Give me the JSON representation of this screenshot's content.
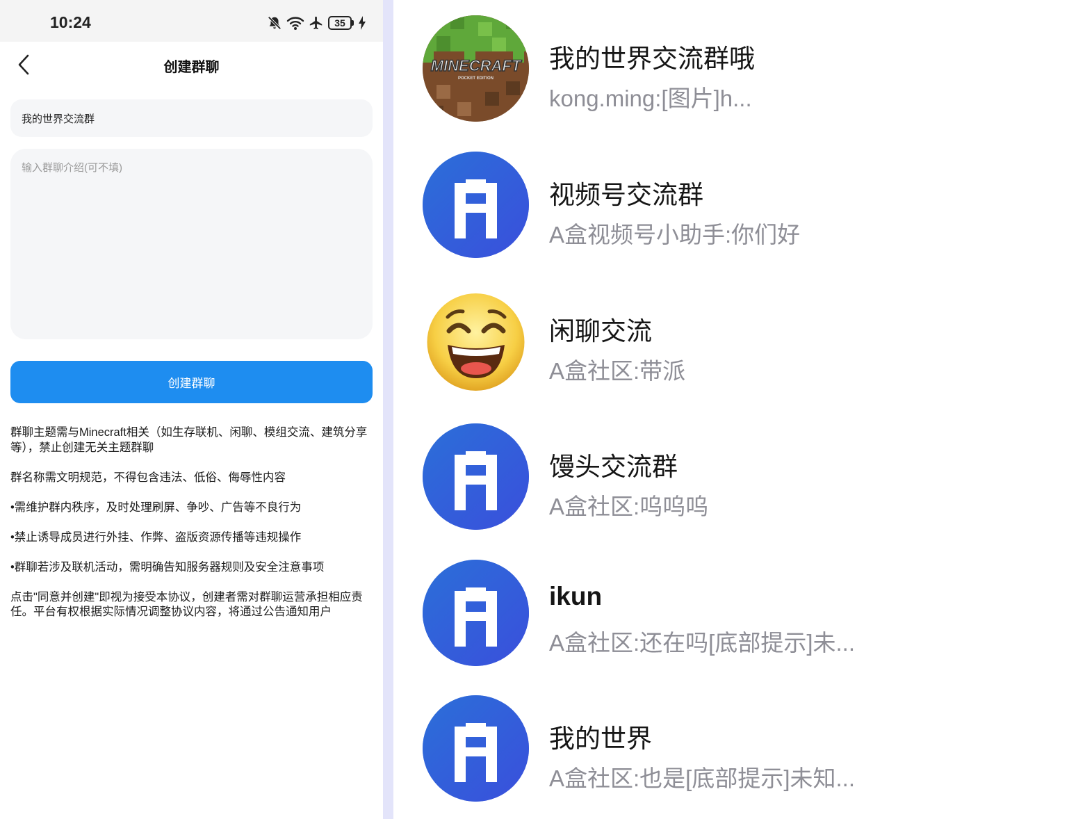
{
  "status_bar": {
    "time": "10:24",
    "battery": "35",
    "icons": [
      "bell-off-icon",
      "wifi-icon",
      "airplane-icon",
      "battery-icon",
      "charging-icon"
    ]
  },
  "create_group": {
    "title": "创建群聊",
    "name_value": "我的世界交流群",
    "intro_placeholder": "输入群聊介绍(可不填)",
    "button_label": "创建群聊",
    "rules": [
      "群聊主题需与Minecraft相关（如生存联机、闲聊、模组交流、建筑分享等），禁止创建无关主题群聊",
      "群名称需文明规范，不得包含违法、低俗、侮辱性内容",
      "•需维护群内秩序，及时处理刷屏、争吵、广告等不良行为",
      "•禁止诱导成员进行外挂、作弊、盗版资源传播等违规操作",
      "•群聊若涉及联机活动，需明确告知服务器规则及安全注意事项",
      "点击\"同意并创建\"即视为接受本协议，创建者需对群聊运营承担相应责任。平台有权根据实际情况调整协议内容，将通过公告通知用户"
    ]
  },
  "chat_list": [
    {
      "name": "我的世界交流群哦",
      "last": "kong.ming:[图片]h...",
      "avatar": "minecraft",
      "avatar_text": "MINECRAFT",
      "avatar_sub": "POCKET EDITION"
    },
    {
      "name": "视频号交流群",
      "last": "A盒视频号小助手:你们好",
      "avatar": "abox"
    },
    {
      "name": "闲聊交流",
      "last": "A盒社区:带派",
      "avatar": "smile"
    },
    {
      "name": "馒头交流群",
      "last": "A盒社区:呜呜呜",
      "avatar": "abox"
    },
    {
      "name": "ikun",
      "last": "A盒社区:还在吗[底部提示]未...",
      "avatar": "abox"
    },
    {
      "name": "我的世界",
      "last": "A盒社区:也是[底部提示]未知...",
      "avatar": "abox"
    }
  ],
  "colors": {
    "primary": "#1e8df0",
    "divider": "#e3e4fa",
    "abox_start": "#2b6fd8",
    "abox_end": "#3a4fdc",
    "muted": "#8e8e96"
  }
}
